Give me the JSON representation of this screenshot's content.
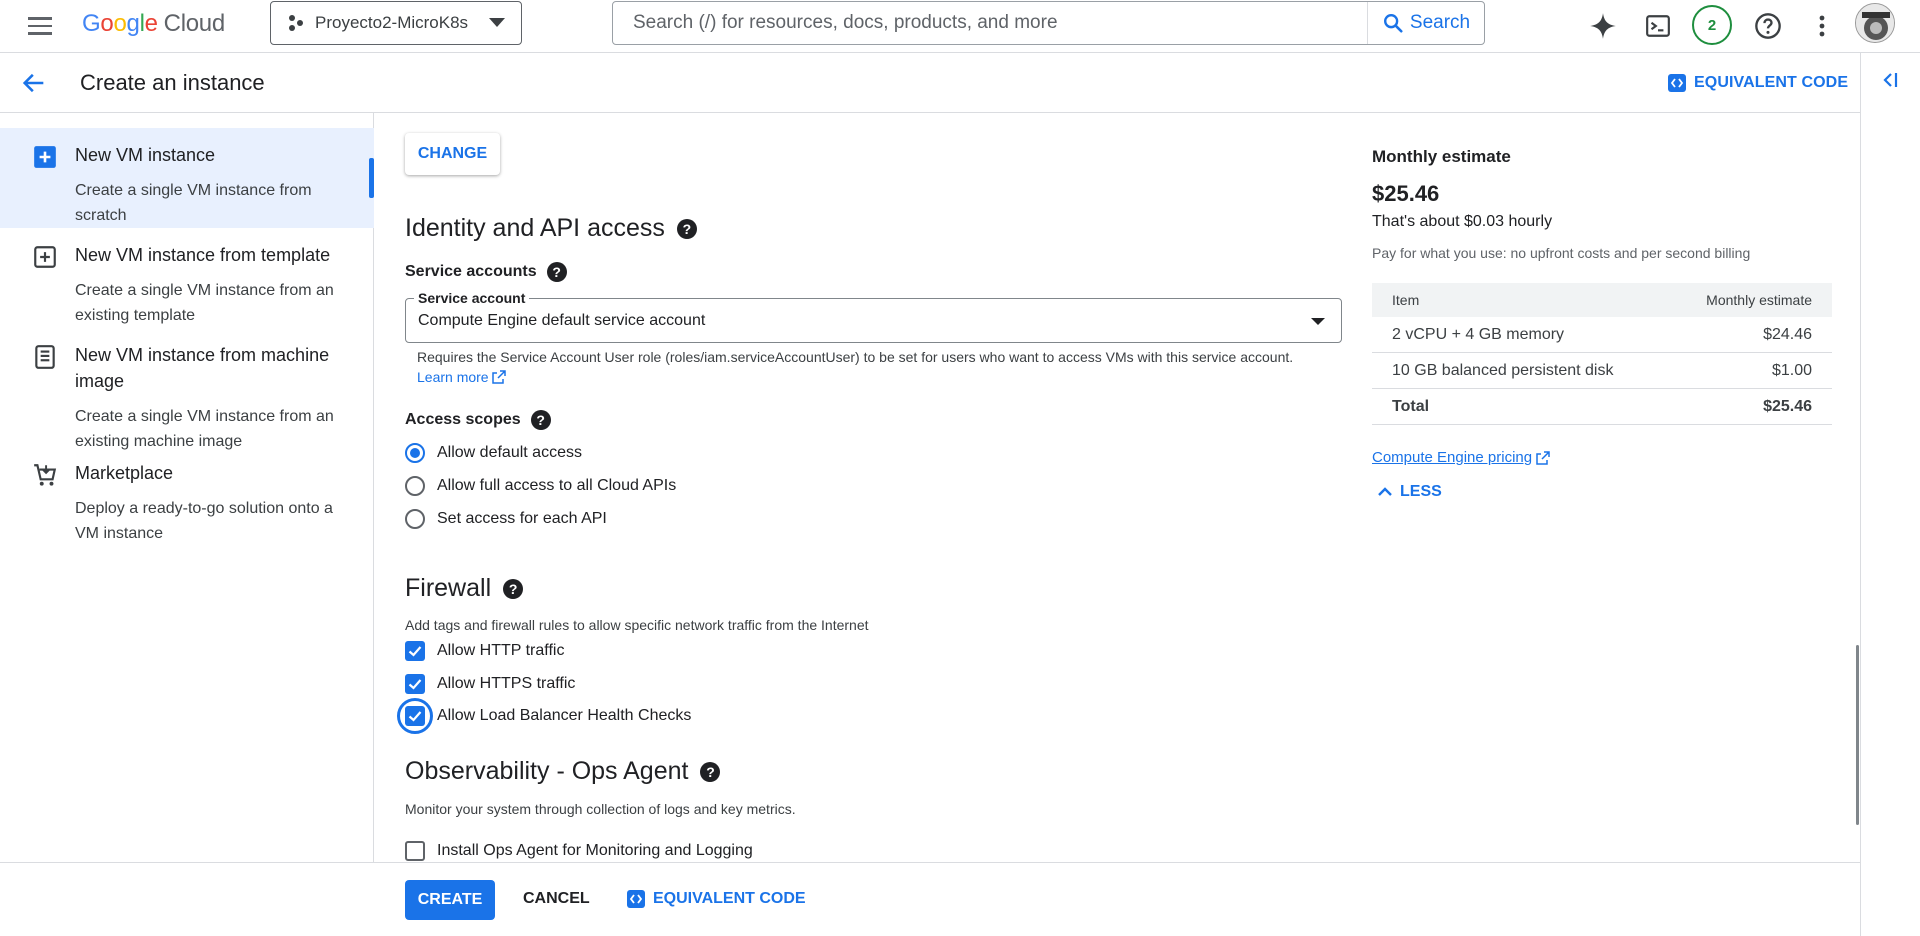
{
  "topbar": {
    "logo_letters": [
      "G",
      "o",
      "o",
      "g",
      "l",
      "e"
    ],
    "logo_product": "Cloud",
    "project_name": "Proyecto2-MicroK8s",
    "search_placeholder": "Search (/) for resources, docs, products, and more",
    "search_button": "Search",
    "notifications_count": "2",
    "icons": [
      "menu-icon",
      "spark-icon",
      "terminal-icon",
      "help-icon",
      "more-vert-icon",
      "avatar"
    ]
  },
  "header": {
    "title": "Create an instance",
    "equivalent_code": "EQUIVALENT CODE"
  },
  "left_nav": {
    "items": [
      {
        "title": "New VM instance",
        "desc": "Create a single VM instance from scratch",
        "active": true
      },
      {
        "title": "New VM instance from template",
        "desc": "Create a single VM instance from an existing template"
      },
      {
        "title": "New VM instance from machine image",
        "desc": "Create a single VM instance from an existing machine image"
      },
      {
        "title": "Marketplace",
        "desc": "Deploy a ready-to-go solution onto a VM instance"
      }
    ]
  },
  "form": {
    "change_button": "CHANGE",
    "identity_title": "Identity and API access",
    "service_accounts_label": "Service accounts",
    "service_account_field_label": "Service account",
    "service_account_value": "Compute Engine default service account",
    "service_account_hint": "Requires the Service Account User role (roles/iam.serviceAccountUser) to be set for users who want to access VMs with this service account.",
    "learn_more": "Learn more",
    "access_scopes_label": "Access scopes",
    "access_scopes": [
      {
        "label": "Allow default access",
        "selected": true
      },
      {
        "label": "Allow full access to all Cloud APIs",
        "selected": false
      },
      {
        "label": "Set access for each API",
        "selected": false
      }
    ],
    "firewall_title": "Firewall",
    "firewall_desc": "Add tags and firewall rules to allow specific network traffic from the Internet",
    "firewall_options": [
      {
        "label": "Allow HTTP traffic",
        "checked": true
      },
      {
        "label": "Allow HTTPS traffic",
        "checked": true
      },
      {
        "label": "Allow Load Balancer Health Checks",
        "checked": true
      }
    ],
    "observability_title": "Observability - Ops Agent",
    "observability_desc": "Monitor your system through collection of logs and key metrics.",
    "ops_agent_label": "Install Ops Agent for Monitoring and Logging",
    "ops_agent_checked": false
  },
  "estimate": {
    "title": "Monthly estimate",
    "price": "$25.46",
    "hourly": "That's about $0.03 hourly",
    "note": "Pay for what you use: no upfront costs and per second billing",
    "columns": [
      "Item",
      "Monthly estimate"
    ],
    "rows": [
      {
        "item": "2 vCPU + 4 GB memory",
        "cost": "$24.46"
      },
      {
        "item": "10 GB balanced persistent disk",
        "cost": "$1.00"
      }
    ],
    "total_label": "Total",
    "total_value": "$25.46",
    "pricing_link": "Compute Engine pricing",
    "less_button": "LESS"
  },
  "footer": {
    "create": "CREATE",
    "cancel": "CANCEL",
    "equivalent_code": "EQUIVALENT CODE"
  },
  "colors": {
    "accent": "#1a73e8",
    "notification_ring": "#1e8e3e"
  }
}
